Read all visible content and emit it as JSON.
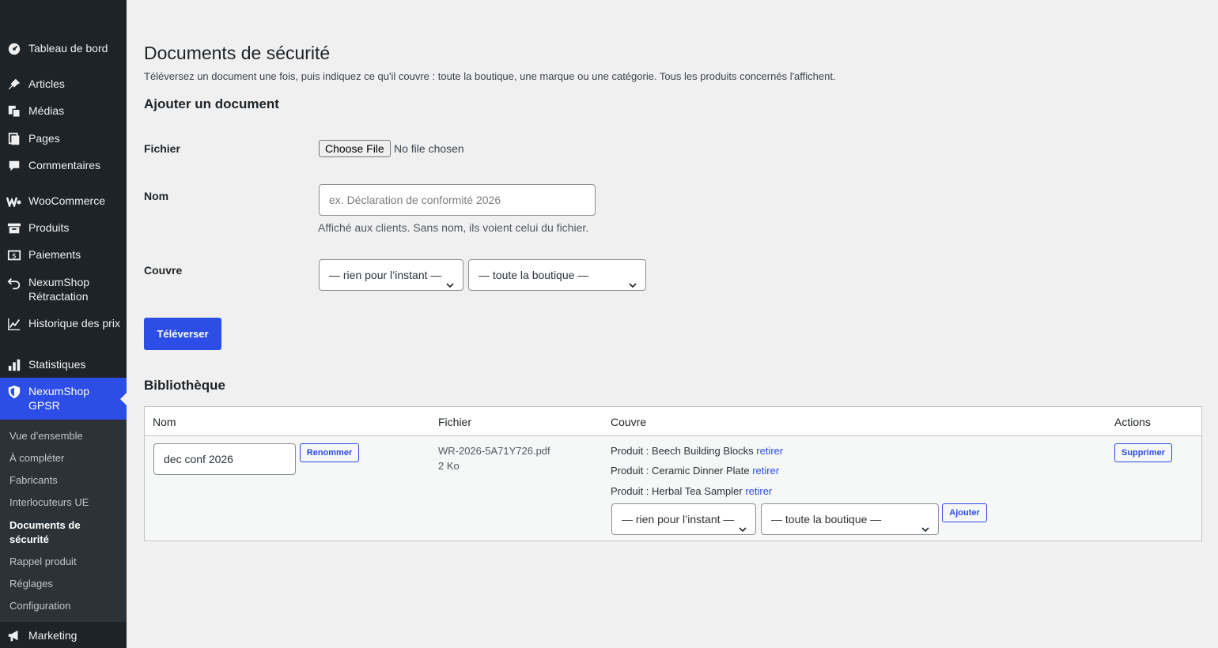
{
  "sidebar": {
    "items": [
      {
        "label": "Tableau de bord",
        "icon": "dashboard-icon"
      },
      {
        "label": "Articles",
        "icon": "pin-icon"
      },
      {
        "label": "Médias",
        "icon": "media-icon"
      },
      {
        "label": "Pages",
        "icon": "pages-icon"
      },
      {
        "label": "Commentaires",
        "icon": "comment-icon"
      },
      {
        "label": "WooCommerce",
        "icon": "woocommerce-icon"
      },
      {
        "label": "Produits",
        "icon": "archive-icon"
      },
      {
        "label": "Paiements",
        "icon": "money-icon"
      },
      {
        "label": "NexumShop Rétractation",
        "icon": "undo-icon"
      },
      {
        "label": "Historique des prix",
        "icon": "chart-line-icon"
      },
      {
        "label": "Statistiques",
        "icon": "bar-chart-icon"
      },
      {
        "label": "NexumShop GPSR",
        "icon": "shield-icon"
      },
      {
        "label": "Marketing",
        "icon": "megaphone-icon"
      }
    ],
    "submenu": [
      "Vue d’ensemble",
      "À compléter",
      "Fabricants",
      "Interlocuteurs UE",
      "Documents de sécurité",
      "Rappel produit",
      "Réglages",
      "Configuration"
    ],
    "accent_color": "#2c4de6"
  },
  "page": {
    "title": "Documents de sécurité",
    "intro": "Téléversez un document une fois, puis indiquez ce qu'il couvre : toute la boutique, une marque ou une catégorie. Tous les produits concernés l'affichent."
  },
  "add_form": {
    "heading": "Ajouter un document",
    "file_label": "Fichier",
    "file_button": "Choose File",
    "file_status": "No file chosen",
    "name_label": "Nom",
    "name_placeholder": "ex. Déclaration de conformité 2026",
    "name_help": "Affiché aux clients. Sans nom, ils voient celui du fichier.",
    "covers_label": "Couvre",
    "type_select": "— rien pour l’instant —",
    "scope_select": "— toute la boutique —",
    "submit": "Téléverser"
  },
  "library": {
    "heading": "Bibliothèque",
    "columns": [
      "Nom",
      "Fichier",
      "Couvre",
      "Actions"
    ],
    "rows": [
      {
        "name_value": "dec conf 2026",
        "rename": "Renommer",
        "file_name": "WR-2026-5A71Y726.pdf",
        "file_size": "2 Ko",
        "covers": [
          {
            "prefix": "Produit : ",
            "name": "Beech Building Blocks",
            "remove": "retirer"
          },
          {
            "prefix": "Produit : ",
            "name": "Ceramic Dinner Plate",
            "remove": "retirer"
          },
          {
            "prefix": "Produit : ",
            "name": "Herbal Tea Sampler",
            "remove": "retirer"
          }
        ],
        "type_select": "— rien pour l’instant —",
        "scope_select": "— toute la boutique —",
        "add": "Ajouter",
        "delete": "Supprimer"
      }
    ]
  }
}
